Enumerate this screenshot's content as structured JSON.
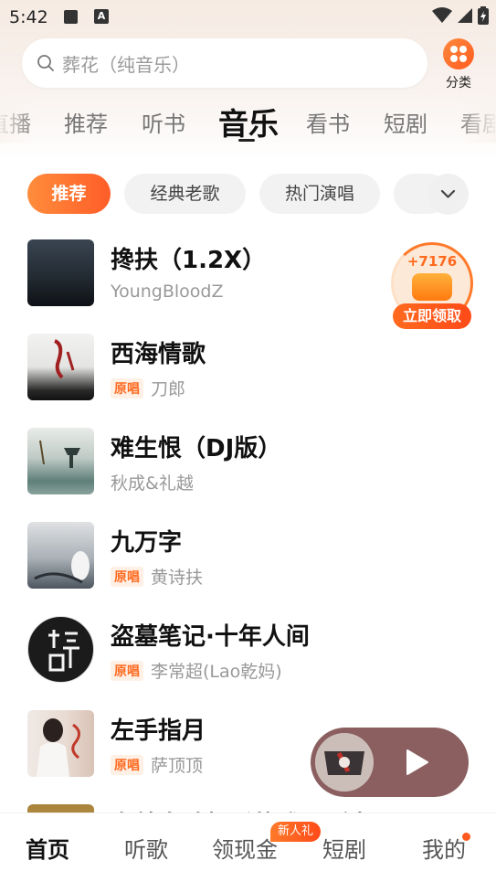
{
  "status_bar": {
    "time": "5:42",
    "a_label": "A"
  },
  "search": {
    "placeholder": "葬花（纯音乐）",
    "category_label": "分类"
  },
  "channel_tabs": [
    "直播",
    "推荐",
    "听书",
    "音乐",
    "看书",
    "短剧",
    "看剧"
  ],
  "active_tab": "音乐",
  "filter_chips": [
    "推荐",
    "经典老歌",
    "热门演唱"
  ],
  "original_badge": "原唱",
  "songs": [
    {
      "title": "搀扶（1.2X）",
      "artist": "YoungBloodZ",
      "original": false
    },
    {
      "title": "西海情歌",
      "artist": "刀郎",
      "original": true
    },
    {
      "title": "难生恨（DJ版）",
      "artist": "秋成&礼越",
      "original": false
    },
    {
      "title": "九万字",
      "artist": "黄诗扶",
      "original": true
    },
    {
      "title": "盗墓笔记·十年人间",
      "artist": "李常超(Lao乾妈)",
      "original": true
    },
    {
      "title": "左手指月",
      "artist": "萨顶顶",
      "original": true
    },
    {
      "title": "向鸽自鸦相爱的戏码（贞显 P",
      "artist": "",
      "original": false
    }
  ],
  "reward": {
    "count": "+7176",
    "button": "立即领取"
  },
  "bottom_nav": {
    "items": [
      "首页",
      "听歌",
      "领现金",
      "短剧",
      "我的"
    ],
    "active": "首页",
    "new_badge": "新人礼"
  },
  "colors": {
    "accent": "#ff6a1f",
    "player_bg": "#8b5f5f"
  }
}
